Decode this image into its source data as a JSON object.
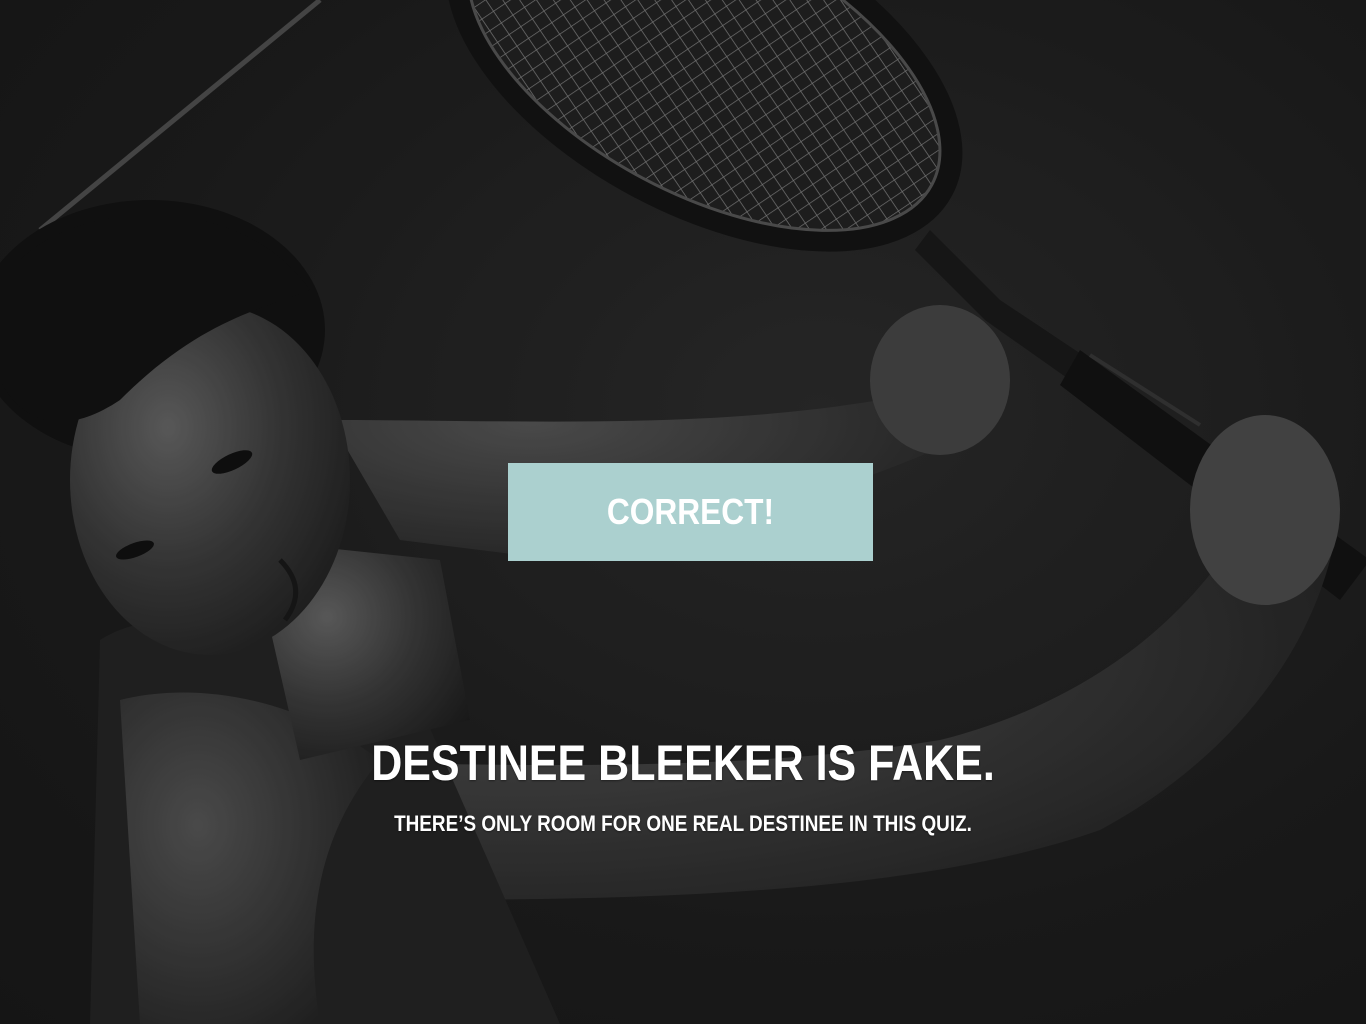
{
  "result": {
    "label": "CORRECT!",
    "color": "#abd0cf"
  },
  "message": {
    "headline": "DESTINEE BLEEKER IS FAKE.",
    "subline": "THERE’S ONLY ROOM FOR ONE REAL DESTINEE IN THIS QUIZ."
  },
  "background": {
    "subject": "tennis-player-photo",
    "tone": "#232323"
  }
}
